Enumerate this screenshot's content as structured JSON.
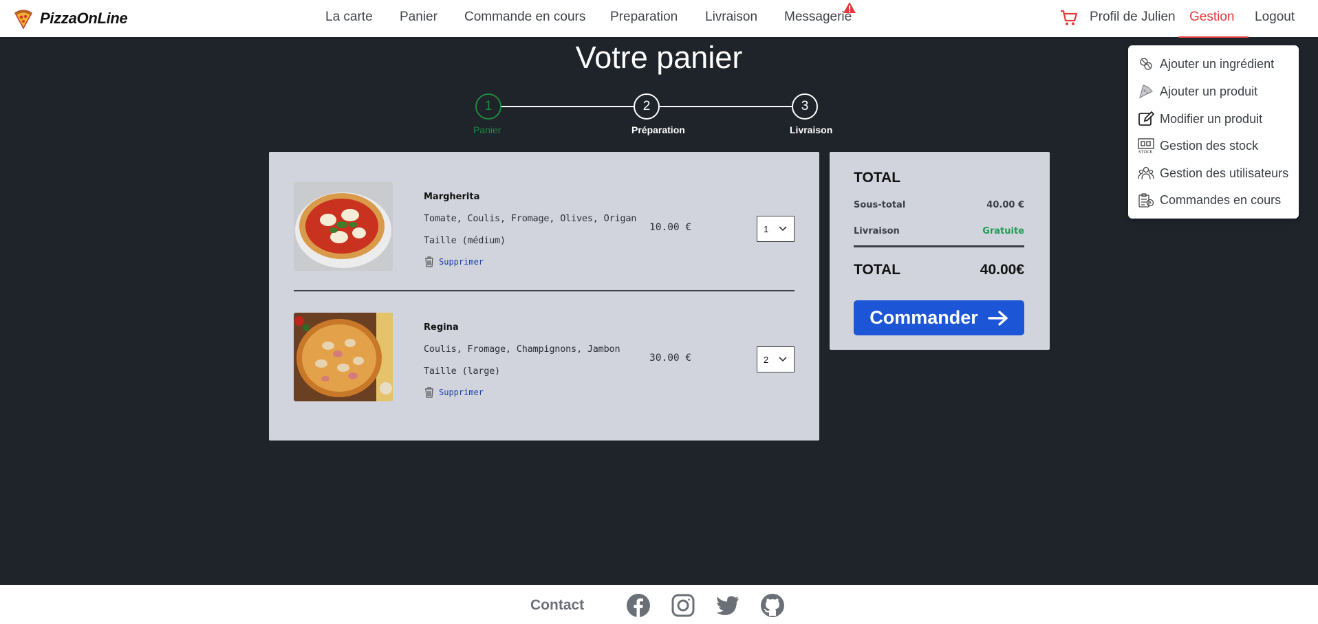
{
  "brand": {
    "name": "PizzaOnLine"
  },
  "nav": {
    "links": [
      "La carte",
      "Panier",
      "Commande en cours",
      "Preparation",
      "Livraison",
      "Messagerie"
    ],
    "profile": "Profil de Julien",
    "gestion": "Gestion",
    "logout": "Logout"
  },
  "dropdown": {
    "items": [
      "Ajouter un ingrédient",
      "Ajouter un produit",
      "Modifier un produit",
      "Gestion des stock",
      "Gestion des utilisateurs",
      "Commandes en cours"
    ]
  },
  "page": {
    "title": "Votre panier"
  },
  "stepper": {
    "steps": [
      {
        "number": "1",
        "label": "Panier"
      },
      {
        "number": "2",
        "label": "Préparation"
      },
      {
        "number": "3",
        "label": "Livraison"
      }
    ],
    "current_step": 1
  },
  "cart": {
    "delete_label": "Supprimer",
    "items": [
      {
        "name": "Margherita",
        "ingredients": "Tomate, Coulis, Fromage, Olives, Origan",
        "size": "Taille (médium)",
        "price": "10.00 €",
        "quantity": "1"
      },
      {
        "name": "Regina",
        "ingredients": "Coulis, Fromage, Champignons, Jambon",
        "size": "Taille (large)",
        "price": "30.00 €",
        "quantity": "2"
      }
    ]
  },
  "summary": {
    "title": "TOTAL",
    "subtotal_label": "Sous-total",
    "subtotal_value": "40.00 €",
    "delivery_label": "Livraison",
    "delivery_value": "Gratuite",
    "total_label": "TOTAL",
    "total_value": "40.00€",
    "order_button": "Commander"
  },
  "footer": {
    "contact": "Contact"
  },
  "colors": {
    "accent_red": "#e23a3a",
    "primary_blue": "#1c55d6",
    "success_green": "#1f8a3d",
    "background": "#1f232a",
    "panel": "#d1d4dc"
  }
}
